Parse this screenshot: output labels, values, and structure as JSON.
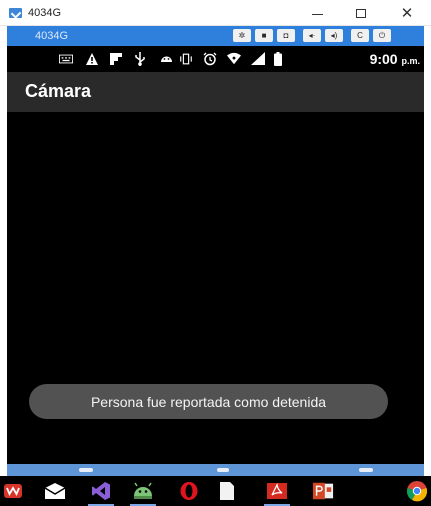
{
  "window": {
    "title": "4034G",
    "close_glyph": "✕"
  },
  "emulator": {
    "title": "4034G",
    "buttons": [
      {
        "icon": "gear-icon",
        "glyph": "✲"
      },
      {
        "icon": "video-camera-icon",
        "glyph": "■"
      },
      {
        "icon": "camera-icon",
        "glyph": "◘"
      },
      {
        "icon": "volume-down-icon",
        "glyph": "◂·"
      },
      {
        "icon": "volume-up-icon",
        "glyph": "◂)"
      },
      {
        "icon": "rotate-icon",
        "glyph": "C"
      },
      {
        "icon": "power-icon",
        "glyph": "⏻"
      }
    ]
  },
  "status_bar": {
    "time": "9:00",
    "period": "p.m.",
    "icons": [
      "keyboard-icon",
      "warning-icon",
      "flipboard-icon",
      "usb-icon",
      "android-icon",
      "vibrate-icon",
      "alarm-icon",
      "wifi-icon",
      "signal-icon",
      "battery-icon"
    ]
  },
  "app": {
    "title": "Cámara",
    "toast": "Persona fue reportada como detenida"
  },
  "taskbar": {
    "apps": [
      "wps-icon",
      "mail-icon",
      "visual-studio-icon",
      "android-studio-icon",
      "opera-icon",
      "file-icon",
      "acrobat-icon",
      "powerpoint-icon",
      "chrome-icon"
    ]
  },
  "colors": {
    "emulator_blue": "#2f7fdd",
    "action_bar": "#2a2a2a",
    "toast_bg": "#525252"
  }
}
